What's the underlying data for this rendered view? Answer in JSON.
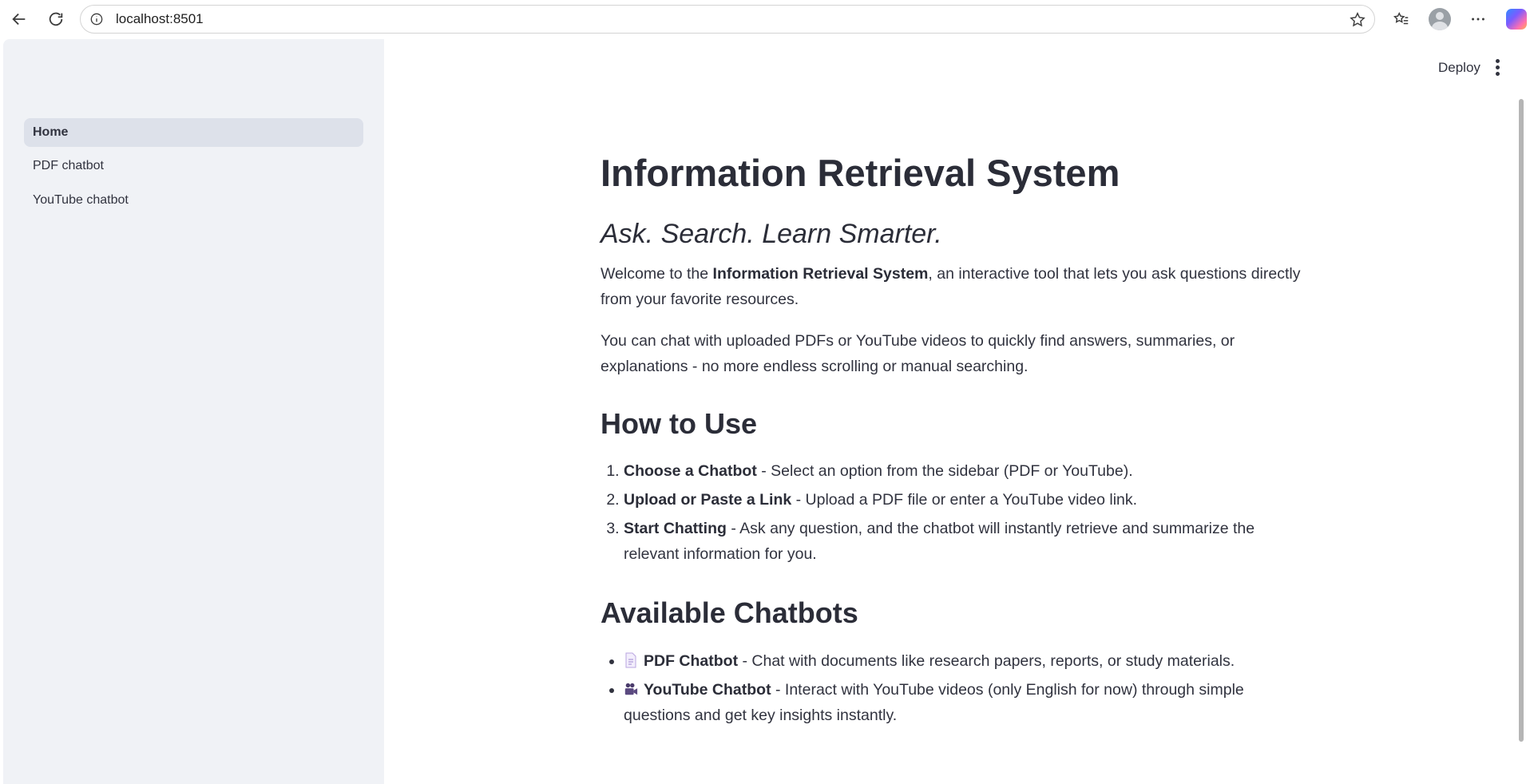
{
  "browser": {
    "url": "localhost:8501"
  },
  "sidebar": {
    "items": [
      {
        "label": "Home"
      },
      {
        "label": "PDF chatbot"
      },
      {
        "label": "YouTube chatbot"
      }
    ]
  },
  "header": {
    "deploy_label": "Deploy"
  },
  "main": {
    "title": "Information Retrieval System",
    "tagline": "Ask. Search. Learn Smarter.",
    "intro": {
      "pre": "Welcome to the ",
      "bold": "Information Retrieval System",
      "post": ", an interactive tool that lets you ask questions directly from your favorite resources."
    },
    "intro2": "You can chat with uploaded PDFs or YouTube videos to quickly find answers, summaries, or explanations - no more endless scrolling or manual searching.",
    "how_to_use": {
      "heading": "How to Use",
      "steps": [
        {
          "bold": "Choose a Chatbot",
          "text": " - Select an option from the sidebar (PDF or YouTube)."
        },
        {
          "bold": "Upload or Paste a Link",
          "text": " - Upload a PDF file or enter a YouTube video link."
        },
        {
          "bold": "Start Chatting",
          "text": " - Ask any question, and the chatbot will instantly retrieve and summarize the relevant information for you."
        }
      ]
    },
    "available": {
      "heading": "Available Chatbots",
      "items": [
        {
          "icon": "document-icon",
          "bold": "PDF Chatbot",
          "text": " - Chat with documents like research papers, reports, or study materials."
        },
        {
          "icon": "video-camera-icon",
          "bold": "YouTube Chatbot",
          "text": " - Interact with YouTube videos (only English for now) through simple questions and get key insights instantly."
        }
      ]
    }
  }
}
